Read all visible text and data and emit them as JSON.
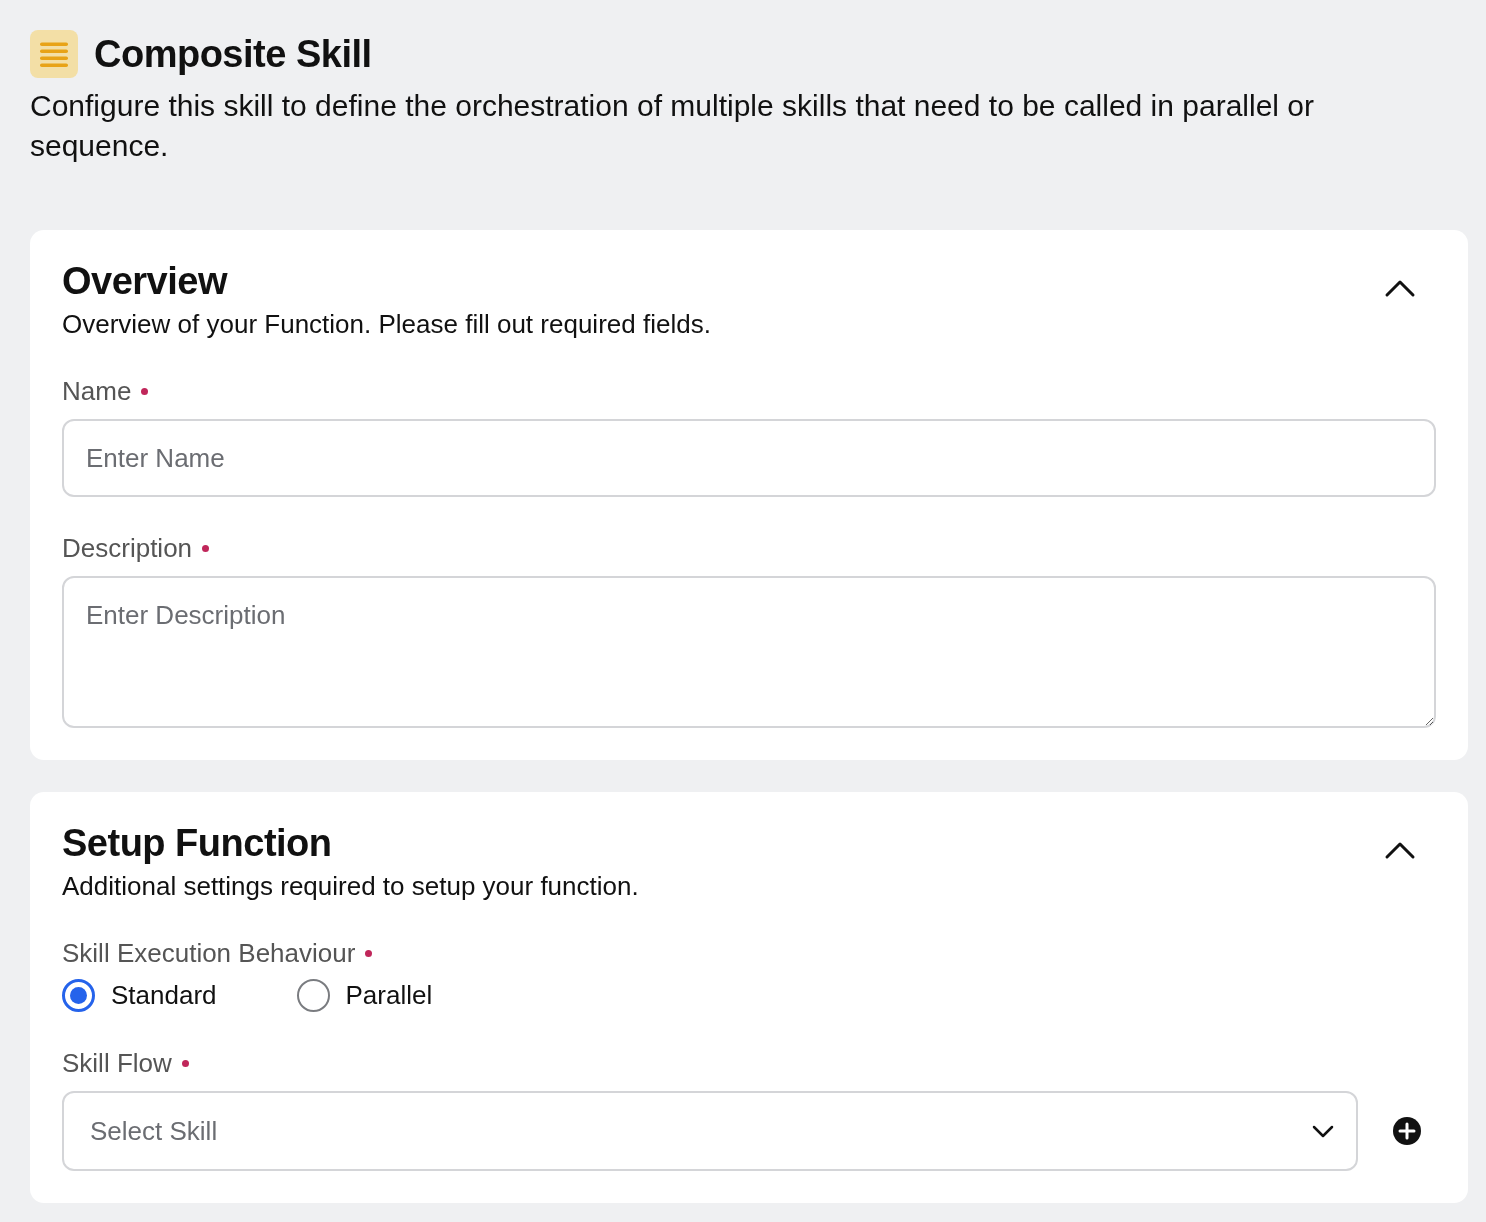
{
  "header": {
    "title": "Composite Skill",
    "description": "Configure this skill to define the orchestration of multiple skills that need to be called in parallel or sequence."
  },
  "sections": [
    {
      "title": "Overview",
      "subtitle": "Overview of your Function. Please fill out required fields.",
      "expanded": true,
      "fields": [
        {
          "kind": "text",
          "label": "Name",
          "required": true,
          "placeholder": "Enter Name"
        },
        {
          "kind": "textarea",
          "label": "Description",
          "required": true,
          "placeholder": "Enter Description"
        }
      ]
    },
    {
      "title": "Setup Function",
      "subtitle": "Additional settings required to setup your function.",
      "expanded": true,
      "fields": [
        {
          "kind": "radio",
          "label": "Skill Execution Behaviour",
          "required": true,
          "options": [
            {
              "label": "Standard",
              "selected": true
            },
            {
              "label": "Parallel",
              "selected": false
            }
          ]
        },
        {
          "kind": "select",
          "label": "Skill Flow",
          "required": true,
          "placeholder": "Select Skill"
        }
      ]
    }
  ]
}
